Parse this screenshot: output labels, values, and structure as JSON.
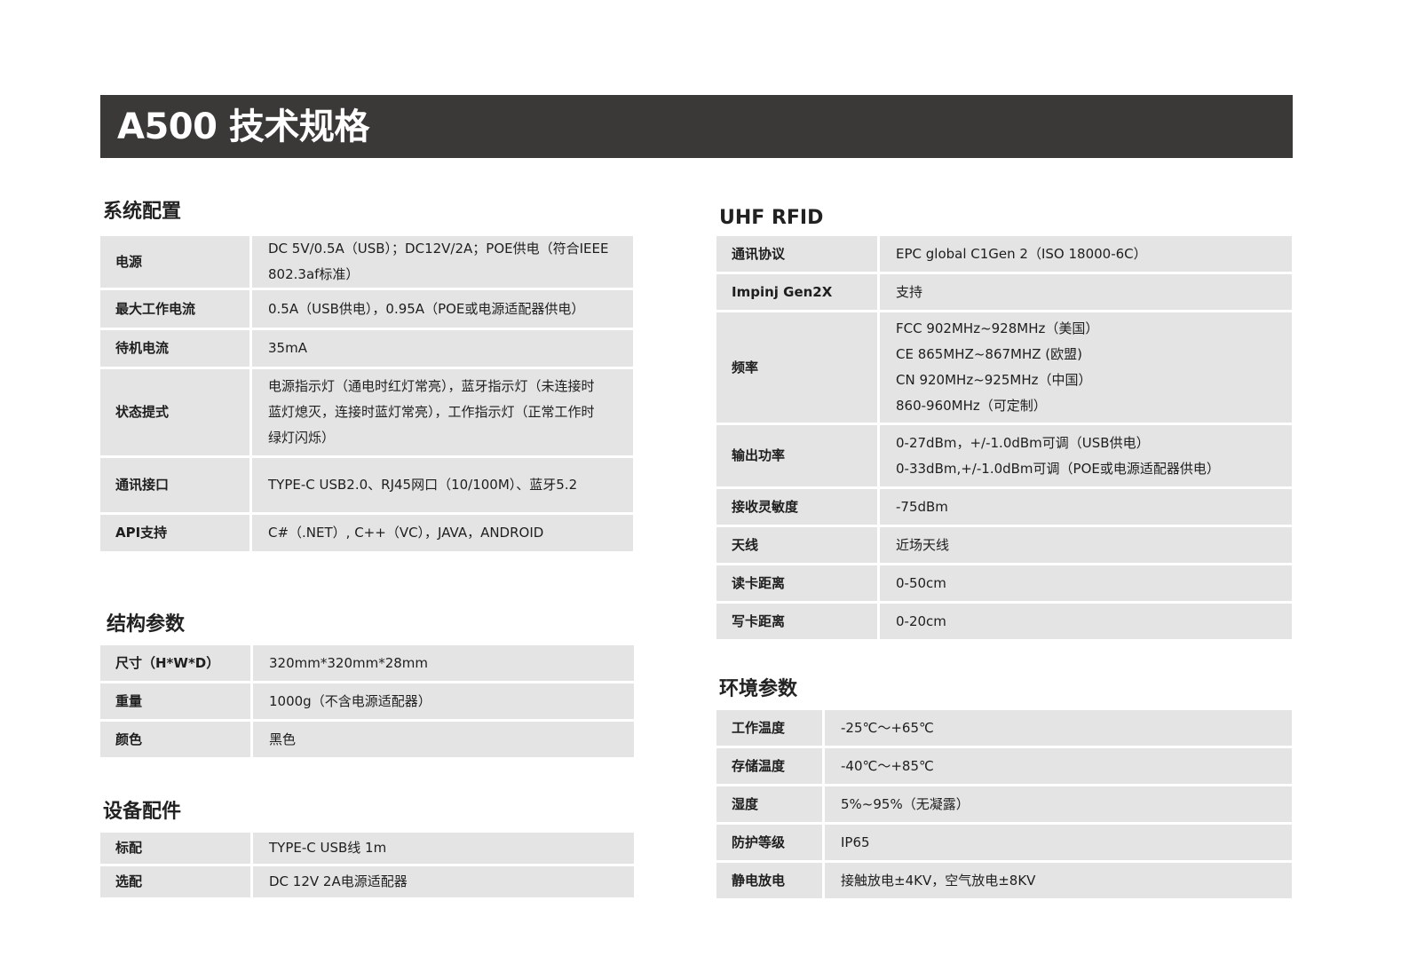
{
  "title": "A500 技术规格",
  "sections": {
    "system": {
      "title": "系统配置",
      "rows": [
        {
          "key": "电源",
          "value": [
            "DC 5V/0.5A（USB）；DC12V/2A；POE供电（符合IEEE",
            "802.3af标准）"
          ]
        },
        {
          "key": "最大工作电流",
          "value": [
            "0.5A（USB供电），0.95A（POE或电源适配器供电）"
          ]
        },
        {
          "key": "待机电流",
          "value": [
            "35mA"
          ]
        },
        {
          "key": "状态提式",
          "value": [
            "电源指示灯（通电时红灯常亮），蓝牙指示灯（未连接时",
            "蓝灯熄灭，连接时蓝灯常亮），工作指示灯（正常工作时",
            "绿灯闪烁）"
          ]
        },
        {
          "key": "通讯接口",
          "value": [
            "TYPE-C USB2.0、RJ45网口（10/100M）、蓝牙5.2"
          ]
        },
        {
          "key": "API支持",
          "value": [
            "C#（.NET）, C++（VC），JAVA，ANDROID"
          ]
        }
      ]
    },
    "structure": {
      "title": "结构参数",
      "rows": [
        {
          "key": "尺寸（H*W*D）",
          "value": [
            "320mm*320mm*28mm"
          ]
        },
        {
          "key": "重量",
          "value": [
            "1000g（不含电源适配器）"
          ]
        },
        {
          "key": "颜色",
          "value": [
            "黑色"
          ]
        }
      ]
    },
    "accessories": {
      "title": "设备配件",
      "rows": [
        {
          "key": "标配",
          "value": [
            "TYPE-C USB线 1m"
          ]
        },
        {
          "key": "选配",
          "value": [
            "DC 12V 2A电源适配器"
          ]
        }
      ]
    },
    "uhf": {
      "title": "UHF RFID",
      "rows": [
        {
          "key": "通讯协议",
          "value": [
            "EPC global C1Gen 2（ISO 18000-6C）"
          ]
        },
        {
          "key": "Impinj Gen2X",
          "value": [
            "支持"
          ]
        },
        {
          "key": "频率",
          "value": [
            "FCC 902MHz~928MHz（美国）",
            "CE  865MHZ~867MHZ (欧盟)",
            "CN  920MHz~925MHz（中国）",
            "860-960MHz（可定制）"
          ]
        },
        {
          "key": "输出功率",
          "value": [
            "0-27dBm，+/-1.0dBm可调（USB供电）",
            "0-33dBm,+/-1.0dBm可调（POE或电源适配器供电）"
          ]
        },
        {
          "key": "接收灵敏度",
          "value": [
            "-75dBm"
          ]
        },
        {
          "key": "天线",
          "value": [
            "近场天线"
          ]
        },
        {
          "key": "读卡距离",
          "value": [
            "0-50cm"
          ]
        },
        {
          "key": "写卡距离",
          "value": [
            "0-20cm"
          ]
        }
      ]
    },
    "environment": {
      "title": "环境参数",
      "rows": [
        {
          "key": "工作温度",
          "value": [
            "-25℃～+65℃"
          ]
        },
        {
          "key": "存储温度",
          "value": [
            "-40℃～+85℃"
          ]
        },
        {
          "key": "湿度",
          "value": [
            "5%~95%（无凝露）"
          ]
        },
        {
          "key": "防护等级",
          "value": [
            "IP65"
          ]
        },
        {
          "key": "静电放电",
          "value": [
            "接触放电±4KV，空气放电±8KV"
          ]
        }
      ]
    }
  }
}
